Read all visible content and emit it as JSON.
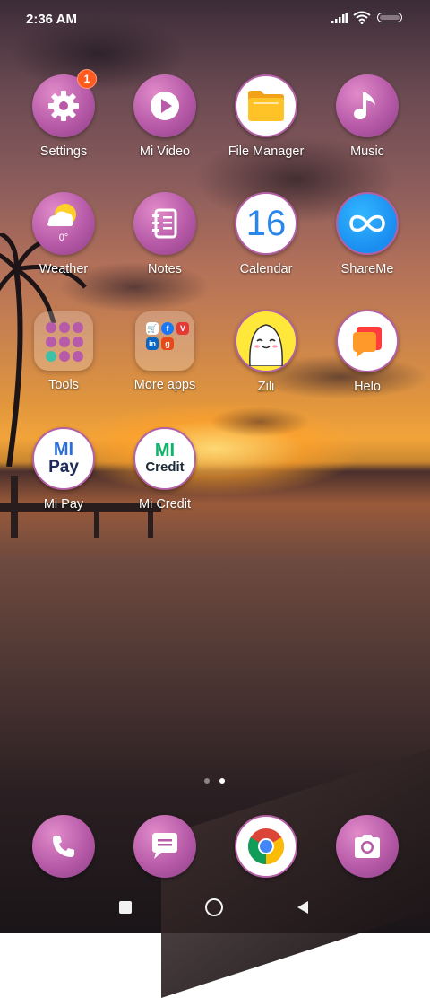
{
  "status_bar": {
    "time": "2:36 AM"
  },
  "apps": {
    "settings": {
      "label": "Settings",
      "badge": "1"
    },
    "mi_video": {
      "label": "Mi Video"
    },
    "file_manager": {
      "label": "File Manager"
    },
    "music": {
      "label": "Music"
    },
    "weather": {
      "label": "Weather",
      "temp": "0°"
    },
    "notes": {
      "label": "Notes"
    },
    "calendar": {
      "label": "Calendar",
      "day": "16"
    },
    "shareme": {
      "label": "ShareMe"
    },
    "tools": {
      "label": "Tools"
    },
    "more_apps": {
      "label": "More apps"
    },
    "zili": {
      "label": "Zili"
    },
    "helo": {
      "label": "Helo"
    },
    "mi_pay": {
      "label": "Mi Pay",
      "logo_top": "MI",
      "logo_bottom": "Pay"
    },
    "mi_credit": {
      "label": "Mi Credit",
      "logo_top": "MI",
      "logo_bottom": "Credit"
    }
  },
  "page_indicator": {
    "total": 2,
    "current": 2
  },
  "colors": {
    "accent": "#b75aa8",
    "badge": "#ff5a1f",
    "mi_blue": "#2a6fdb",
    "mi_green": "#11b36b"
  }
}
